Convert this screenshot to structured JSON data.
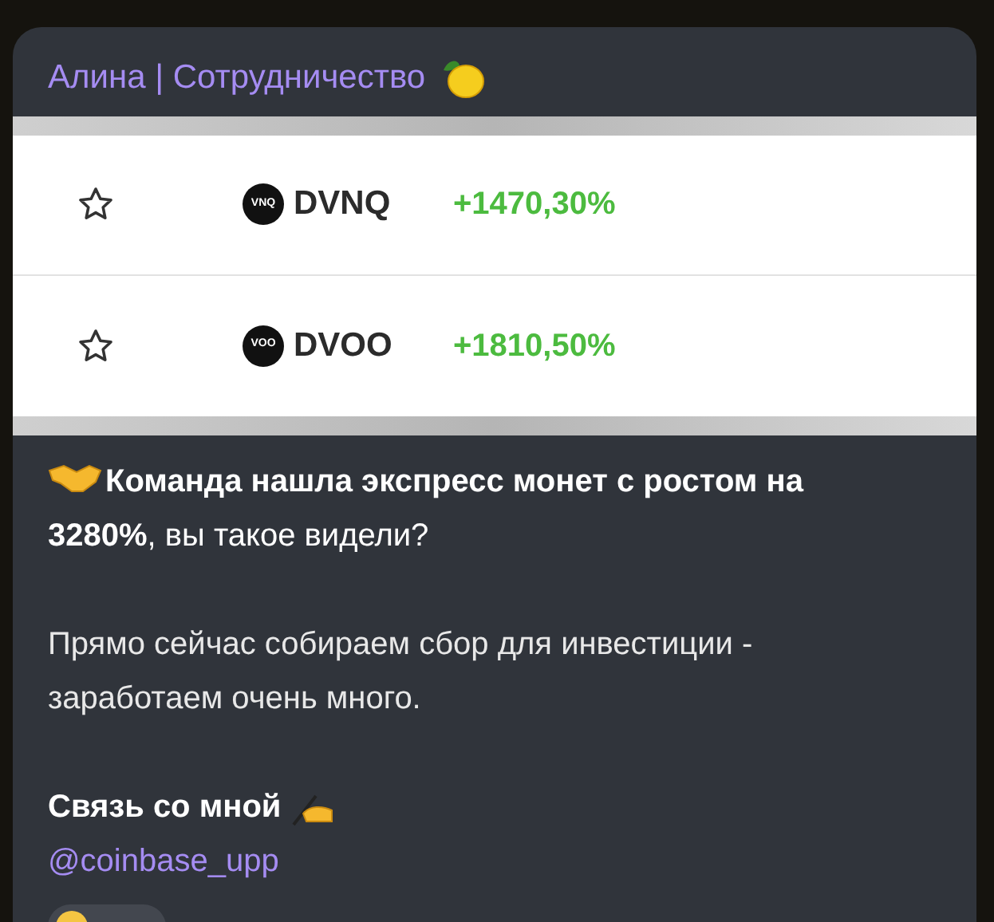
{
  "message": {
    "sender": "Алина | Сотрудничество",
    "screenshot": {
      "rows": [
        {
          "ticker": "DVNQ",
          "logo_text": "VNQ",
          "change": "+1470,30%",
          "favorite": false
        },
        {
          "ticker": "DVOO",
          "logo_text": "VOO",
          "change": "+1810,50%",
          "favorite": false
        }
      ]
    },
    "lead": "**Команда нашла экспресс монет с ростом на 3280%**, вы такое видели?",
    "body": "Прямо сейчас собираем сбор для инвестиции - заработаем очень много.",
    "contact": "Связь со мной",
    "mention": "@coinbase_upp"
  }
}
